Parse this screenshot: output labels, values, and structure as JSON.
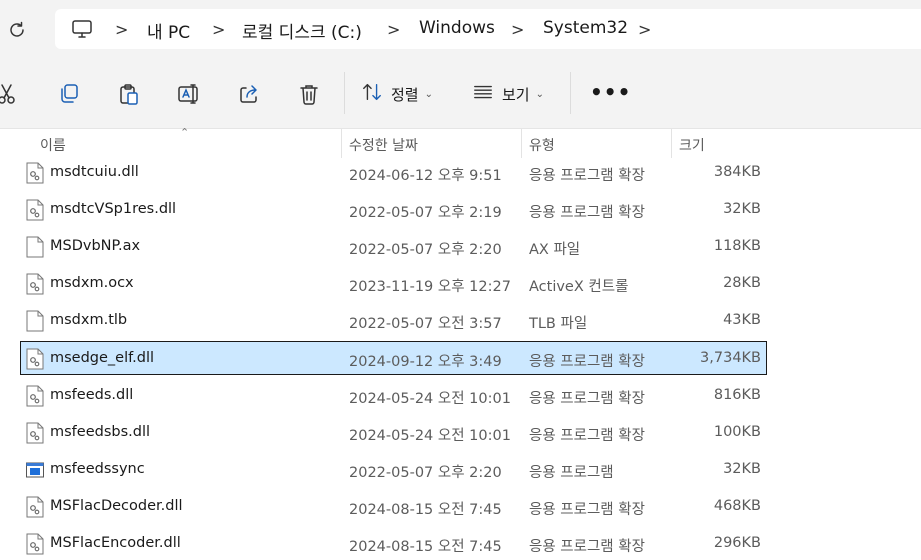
{
  "breadcrumb": {
    "items": [
      "내 PC",
      "로컬 디스크 (C:)",
      "Windows",
      "System32"
    ],
    "separator": ">"
  },
  "toolbar": {
    "sort_label": "정렬",
    "view_label": "보기",
    "more_label": "•••",
    "icons": [
      "cut-icon",
      "copy-icon",
      "paste-icon",
      "rename-icon",
      "share-icon",
      "delete-icon"
    ]
  },
  "columns": {
    "name": "이름",
    "date": "수정한 날짜",
    "type": "유형",
    "size": "크기"
  },
  "files": [
    {
      "name": "msdtcuiu.dll",
      "date": "2024-06-12 오후 9:51",
      "type": "응용 프로그램 확장",
      "size": "384KB",
      "icon": "dll-icon",
      "selected": false
    },
    {
      "name": "msdtcVSp1res.dll",
      "date": "2022-05-07 오후 2:19",
      "type": "응용 프로그램 확장",
      "size": "32KB",
      "icon": "dll-icon",
      "selected": false
    },
    {
      "name": "MSDvbNP.ax",
      "date": "2022-05-07 오후 2:20",
      "type": "AX 파일",
      "size": "118KB",
      "icon": "file-icon",
      "selected": false
    },
    {
      "name": "msdxm.ocx",
      "date": "2023-11-19 오후 12:27",
      "type": "ActiveX 컨트롤",
      "size": "28KB",
      "icon": "dll-icon",
      "selected": false
    },
    {
      "name": "msdxm.tlb",
      "date": "2022-05-07 오전 3:57",
      "type": "TLB 파일",
      "size": "43KB",
      "icon": "file-icon",
      "selected": false
    },
    {
      "name": "msedge_elf.dll",
      "date": "2024-09-12 오후 3:49",
      "type": "응용 프로그램 확장",
      "size": "3,734KB",
      "icon": "dll-icon",
      "selected": true
    },
    {
      "name": "msfeeds.dll",
      "date": "2024-05-24 오전 10:01",
      "type": "응용 프로그램 확장",
      "size": "816KB",
      "icon": "dll-icon",
      "selected": false
    },
    {
      "name": "msfeedsbs.dll",
      "date": "2024-05-24 오전 10:01",
      "type": "응용 프로그램 확장",
      "size": "100KB",
      "icon": "dll-icon",
      "selected": false
    },
    {
      "name": "msfeedssync",
      "date": "2022-05-07 오후 2:20",
      "type": "응용 프로그램",
      "size": "32KB",
      "icon": "exe-icon",
      "selected": false
    },
    {
      "name": "MSFlacDecoder.dll",
      "date": "2024-08-15 오전 7:45",
      "type": "응용 프로그램 확장",
      "size": "468KB",
      "icon": "dll-icon",
      "selected": false
    },
    {
      "name": "MSFlacEncoder.dll",
      "date": "2024-08-15 오전 7:45",
      "type": "응용 프로그램 확장",
      "size": "296KB",
      "icon": "dll-icon",
      "selected": false
    }
  ]
}
